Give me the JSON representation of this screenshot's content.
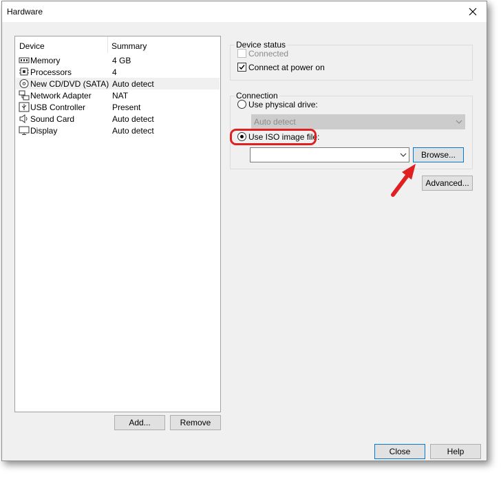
{
  "window": {
    "title": "Hardware"
  },
  "device_list": {
    "columns": [
      "Device",
      "Summary"
    ],
    "rows": [
      {
        "device": "Memory",
        "summary": "4 GB",
        "icon": "memory-icon"
      },
      {
        "device": "Processors",
        "summary": "4",
        "icon": "processor-icon"
      },
      {
        "device": "New CD/DVD (SATA)",
        "summary": "Auto detect",
        "icon": "cd-dvd-icon",
        "selected": true
      },
      {
        "device": "Network Adapter",
        "summary": "NAT",
        "icon": "network-adapter-icon"
      },
      {
        "device": "USB Controller",
        "summary": "Present",
        "icon": "usb-icon"
      },
      {
        "device": "Sound Card",
        "summary": "Auto detect",
        "icon": "speaker-icon"
      },
      {
        "device": "Display",
        "summary": "Auto detect",
        "icon": "monitor-icon"
      }
    ]
  },
  "list_buttons": {
    "add": "Add...",
    "remove": "Remove"
  },
  "device_status": {
    "title": "Device status",
    "connected": {
      "label": "Connected",
      "checked": false,
      "disabled": true
    },
    "connect_at_power_on": {
      "label": "Connect at power on",
      "checked": true
    }
  },
  "connection": {
    "title": "Connection",
    "use_physical_drive": {
      "label": "Use physical drive:",
      "selected": false
    },
    "physical_drive_value": "Auto detect",
    "use_iso": {
      "label": "Use ISO image file:",
      "selected": true
    },
    "iso_path_value": "",
    "browse_label": "Browse..."
  },
  "advanced_label": "Advanced...",
  "footer": {
    "close": "Close",
    "help": "Help"
  },
  "colors": {
    "highlight": "#e02020",
    "accent": "#0078d7"
  }
}
